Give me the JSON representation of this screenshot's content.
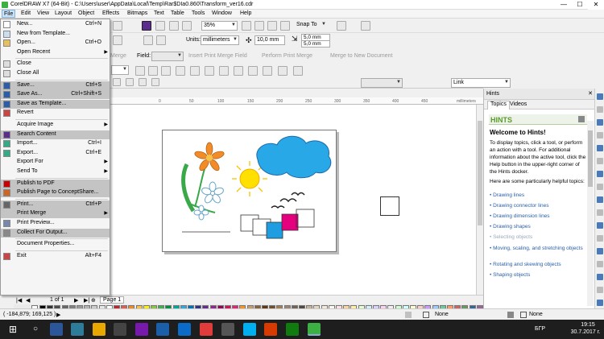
{
  "window": {
    "title": "CorelDRAW X7 (64-Bit) - C:\\Users\\user\\AppData\\Local\\Temp\\Rar$DIa0.860\\Transform_ver16.cdr",
    "minimize": "—",
    "maximize": "☐",
    "close": "✕"
  },
  "menubar": [
    "File",
    "Edit",
    "View",
    "Layout",
    "Object",
    "Effects",
    "Bitmaps",
    "Text",
    "Table",
    "Tools",
    "Window",
    "Help"
  ],
  "toolbar": {
    "zoom": "35%",
    "snap": "Snap To",
    "units_label": "Units:",
    "units": "millimeters",
    "nudge": "10,0 mm",
    "dup_x": "5,0 mm",
    "dup_y": "5,0 mm",
    "merge_field": "Field:",
    "merge_btn_insert": "Insert Print Merge Field",
    "merge_btn_perform": "Perform Print Merge",
    "merge_btn_new": "Merge to New Document",
    "merge_prefix": "Merge",
    "link": "Link"
  },
  "file_menu": [
    {
      "label": "New...",
      "shortcut": "Ctrl+N",
      "icon": "new-icon"
    },
    {
      "label": "New from Template...",
      "shortcut": "",
      "icon": "template-icon"
    },
    {
      "label": "Open...",
      "shortcut": "Ctrl+O",
      "icon": "open-icon"
    },
    {
      "label": "Open Recent",
      "shortcut": "",
      "sub": true,
      "icon": ""
    },
    {
      "sep": true
    },
    {
      "label": "Close",
      "shortcut": "",
      "icon": "close-doc-icon"
    },
    {
      "label": "Close All",
      "shortcut": "",
      "icon": "close-all-icon"
    },
    {
      "sep": true
    },
    {
      "label": "Save...",
      "shortcut": "Ctrl+S",
      "icon": "save-icon",
      "hl": true
    },
    {
      "label": "Save As...",
      "shortcut": "Ctrl+Shift+S",
      "icon": "save-as-icon",
      "hl": true
    },
    {
      "label": "Save as Template...",
      "shortcut": "",
      "icon": "save-template-icon",
      "hl": true
    },
    {
      "label": "Revert",
      "shortcut": "",
      "icon": "revert-icon"
    },
    {
      "sep": true
    },
    {
      "label": "Acquire Image",
      "shortcut": "",
      "sub": true,
      "icon": ""
    },
    {
      "label": "Search Content",
      "shortcut": "",
      "icon": "search-content-icon",
      "hl": true
    },
    {
      "label": "Import...",
      "shortcut": "Ctrl+I",
      "icon": "import-icon"
    },
    {
      "label": "Export...",
      "shortcut": "Ctrl+E",
      "icon": "export-icon"
    },
    {
      "label": "Export For",
      "shortcut": "",
      "sub": true,
      "icon": ""
    },
    {
      "label": "Send To",
      "shortcut": "",
      "sub": true,
      "icon": ""
    },
    {
      "sep": true
    },
    {
      "label": "Publish to PDF",
      "shortcut": "",
      "icon": "pdf-icon",
      "hl": true
    },
    {
      "label": "Publish Page to ConceptShare...",
      "shortcut": "",
      "icon": "conceptshare-icon",
      "hl": true
    },
    {
      "sep": true
    },
    {
      "label": "Print...",
      "shortcut": "Ctrl+P",
      "icon": "print-icon",
      "hl": true
    },
    {
      "label": "Print Merge",
      "shortcut": "",
      "sub": true,
      "icon": "",
      "hl": true
    },
    {
      "label": "Print Preview...",
      "shortcut": "",
      "icon": "print-preview-icon"
    },
    {
      "label": "Collect For Output...",
      "shortcut": "",
      "icon": "collect-icon",
      "hl": true
    },
    {
      "sep": true
    },
    {
      "label": "Document Properties...",
      "shortcut": "",
      "icon": ""
    },
    {
      "sep": true
    },
    {
      "label": "Exit",
      "shortcut": "Alt+F4",
      "icon": "exit-icon"
    }
  ],
  "ruler": {
    "unit": "millimeters",
    "ticks": [
      "0",
      "50",
      "100",
      "150",
      "200",
      "250",
      "300",
      "350",
      "400",
      "450"
    ]
  },
  "page_nav": {
    "of": "1 of 1",
    "page_tab": "Page 1"
  },
  "status": {
    "coords": "( -184,879; 169,125 )",
    "fill": "None",
    "outline": "None"
  },
  "hints": {
    "panel_title": "Hints",
    "tab_topics": "Topics",
    "tab_videos": "Videos",
    "header": "HINTS",
    "welcome": "Welcome to Hints!",
    "para1": "To display topics, click a tool, or perform an action with a tool. For additional information about the active tool, click the Help button in the upper-right corner of the Hints docker.",
    "para2": "Here are some particularly helpful topics:",
    "links": [
      "Drawing lines",
      "Drawing connector lines",
      "Drawing dimension lines",
      "Drawing shapes",
      "Selecting objects",
      "Moving, scaling, and stretching objects",
      "Rotating and skewing objects",
      "Shaping objects"
    ]
  },
  "taskbar": {
    "lang": "БГР",
    "time": "19:15",
    "date": "30.7.2017 г."
  },
  "palette": [
    "#000000",
    "#333333",
    "#4d4d4d",
    "#666666",
    "#808080",
    "#999999",
    "#b3b3b3",
    "#cccccc",
    "#e6e6e6",
    "#ffffff",
    "#c0272d",
    "#e55c4d",
    "#f08a24",
    "#f6c343",
    "#fff200",
    "#8cc63f",
    "#39b54a",
    "#009245",
    "#00a99d",
    "#29abe2",
    "#0071bc",
    "#2e3192",
    "#662d91",
    "#93278f",
    "#9e005d",
    "#d4145a",
    "#ed1e79",
    "#f7931e",
    "#c69c6d",
    "#8c6239",
    "#603813",
    "#754c24",
    "#a67c52",
    "#998675",
    "#736357",
    "#534741",
    "#c7b299",
    "#e6d6bf",
    "#f2e9d8",
    "#fbf7ee",
    "#ffe0e0",
    "#ffd0a0",
    "#fff0a0",
    "#e0ffd0",
    "#d0f0ff",
    "#d8d0ff",
    "#ffd0f0",
    "#f0f0f0",
    "#ccffcc",
    "#ccffff",
    "#ffffcc",
    "#ffcccc",
    "#cc99ff",
    "#99ccff",
    "#66cc99",
    "#ff9966",
    "#cc6666",
    "#669966",
    "#336699",
    "#996699",
    "#cccc99",
    "#99cccc"
  ]
}
